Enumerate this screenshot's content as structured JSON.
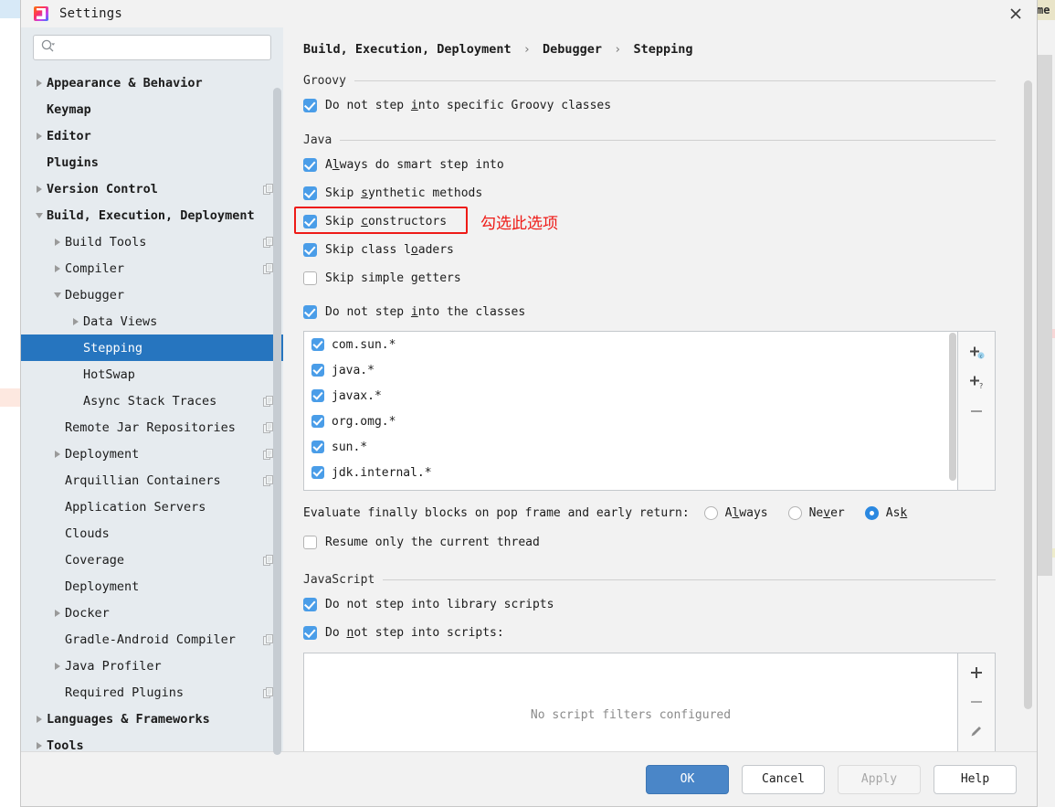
{
  "window": {
    "title": "Settings",
    "app_icon": "intellij-idea-icon",
    "close_label": "close-icon"
  },
  "sidebar": {
    "search": {
      "placeholder": "",
      "value": "",
      "icon": "search-icon"
    },
    "items": [
      {
        "label": "Appearance & Behavior",
        "level": 0,
        "arrow": "right",
        "bold": true,
        "copy": false,
        "selected": false
      },
      {
        "label": "Keymap",
        "level": 0,
        "arrow": "none",
        "bold": true,
        "copy": false,
        "selected": false
      },
      {
        "label": "Editor",
        "level": 0,
        "arrow": "right",
        "bold": true,
        "copy": false,
        "selected": false
      },
      {
        "label": "Plugins",
        "level": 0,
        "arrow": "none",
        "bold": true,
        "copy": false,
        "selected": false
      },
      {
        "label": "Version Control",
        "level": 0,
        "arrow": "right",
        "bold": true,
        "copy": true,
        "selected": false
      },
      {
        "label": "Build, Execution, Deployment",
        "level": 0,
        "arrow": "down",
        "bold": true,
        "copy": false,
        "selected": false
      },
      {
        "label": "Build Tools",
        "level": 1,
        "arrow": "right",
        "bold": false,
        "copy": true,
        "selected": false
      },
      {
        "label": "Compiler",
        "level": 1,
        "arrow": "right",
        "bold": false,
        "copy": true,
        "selected": false
      },
      {
        "label": "Debugger",
        "level": 1,
        "arrow": "down",
        "bold": false,
        "copy": false,
        "selected": false
      },
      {
        "label": "Data Views",
        "level": 2,
        "arrow": "right",
        "bold": false,
        "copy": false,
        "selected": false
      },
      {
        "label": "Stepping",
        "level": 2,
        "arrow": "none",
        "bold": false,
        "copy": false,
        "selected": true
      },
      {
        "label": "HotSwap",
        "level": 2,
        "arrow": "none",
        "bold": false,
        "copy": false,
        "selected": false
      },
      {
        "label": "Async Stack Traces",
        "level": 2,
        "arrow": "none",
        "bold": false,
        "copy": true,
        "selected": false
      },
      {
        "label": "Remote Jar Repositories",
        "level": 1,
        "arrow": "none",
        "bold": false,
        "copy": true,
        "selected": false
      },
      {
        "label": "Deployment",
        "level": 1,
        "arrow": "right",
        "bold": false,
        "copy": true,
        "selected": false
      },
      {
        "label": "Arquillian Containers",
        "level": 1,
        "arrow": "none",
        "bold": false,
        "copy": true,
        "selected": false
      },
      {
        "label": "Application Servers",
        "level": 1,
        "arrow": "none",
        "bold": false,
        "copy": false,
        "selected": false
      },
      {
        "label": "Clouds",
        "level": 1,
        "arrow": "none",
        "bold": false,
        "copy": false,
        "selected": false
      },
      {
        "label": "Coverage",
        "level": 1,
        "arrow": "none",
        "bold": false,
        "copy": true,
        "selected": false
      },
      {
        "label": "Deployment",
        "level": 1,
        "arrow": "none",
        "bold": false,
        "copy": false,
        "selected": false
      },
      {
        "label": "Docker",
        "level": 1,
        "arrow": "right",
        "bold": false,
        "copy": false,
        "selected": false
      },
      {
        "label": "Gradle-Android Compiler",
        "level": 1,
        "arrow": "none",
        "bold": false,
        "copy": true,
        "selected": false
      },
      {
        "label": "Java Profiler",
        "level": 1,
        "arrow": "right",
        "bold": false,
        "copy": false,
        "selected": false
      },
      {
        "label": "Required Plugins",
        "level": 1,
        "arrow": "none",
        "bold": false,
        "copy": true,
        "selected": false
      },
      {
        "label": "Languages & Frameworks",
        "level": 0,
        "arrow": "right",
        "bold": true,
        "copy": false,
        "selected": false
      },
      {
        "label": "Tools",
        "level": 0,
        "arrow": "right",
        "bold": true,
        "copy": false,
        "selected": false
      }
    ]
  },
  "main": {
    "breadcrumb": {
      "part1": "Build, Execution, Deployment",
      "part2": "Debugger",
      "part3": "Stepping",
      "separator": "›"
    },
    "groovy": {
      "title": "Groovy",
      "options": [
        {
          "label_pre": "Do not step ",
          "label_u": "i",
          "label_post": "nto specific Groovy classes",
          "checked": true
        }
      ]
    },
    "java": {
      "title": "Java",
      "options": [
        {
          "label_pre": "A",
          "label_u": "l",
          "label_post": "ways do smart step into",
          "checked": true
        },
        {
          "label_pre": "Skip ",
          "label_u": "s",
          "label_post": "ynthetic methods",
          "checked": true
        },
        {
          "label_pre": "Skip ",
          "label_u": "c",
          "label_post": "onstructors",
          "checked": true
        },
        {
          "label_pre": "Skip class l",
          "label_u": "o",
          "label_post": "aders",
          "checked": true
        },
        {
          "label_pre": "Skip simple ",
          "label_u": "g",
          "label_post": "etters",
          "checked": false
        },
        {
          "label_pre": "Do not step ",
          "label_u": "i",
          "label_post": "nto the classes",
          "checked": true
        }
      ],
      "class_filters": [
        {
          "pattern": "com.sun.*",
          "checked": true
        },
        {
          "pattern": "java.*",
          "checked": true
        },
        {
          "pattern": "javax.*",
          "checked": true
        },
        {
          "pattern": "org.omg.*",
          "checked": true
        },
        {
          "pattern": "sun.*",
          "checked": true
        },
        {
          "pattern": "jdk.internal.*",
          "checked": true
        }
      ],
      "class_buttons": [
        {
          "icon": "add-class-icon",
          "name": "add-class-button"
        },
        {
          "icon": "add-pattern-icon",
          "name": "add-pattern-button"
        },
        {
          "icon": "remove-icon",
          "name": "remove-class-button"
        }
      ],
      "evaluate_label": "Evaluate finally blocks on pop frame and early return:",
      "evaluate_options": [
        {
          "pre": "A",
          "u": "l",
          "post": "ways",
          "selected": false
        },
        {
          "pre": "Ne",
          "u": "v",
          "post": "er",
          "selected": false
        },
        {
          "pre": "As",
          "u": "k",
          "post": "",
          "selected": true
        }
      ],
      "resume_option": {
        "label": "Resume only the current thread",
        "checked": false
      }
    },
    "javascript": {
      "title": "JavaScript",
      "options": [
        {
          "label_pre": "Do not step into library scripts",
          "label_u": "",
          "label_post": "",
          "checked": true
        },
        {
          "label_pre": "Do ",
          "label_u": "n",
          "label_post": "ot step into scripts:",
          "checked": true
        }
      ],
      "empty_text": "No script filters configured",
      "script_buttons": [
        {
          "icon": "plus-icon",
          "name": "add-script-filter-button"
        },
        {
          "icon": "minus-icon",
          "name": "remove-script-filter-button"
        },
        {
          "icon": "pencil-icon",
          "name": "edit-script-filter-button"
        },
        {
          "icon": "up-arrow-icon",
          "name": "move-up-script-filter-button"
        }
      ]
    },
    "annotation": {
      "text": "勾选此选项",
      "color": "#ee1b17",
      "target": "Skip constructors"
    }
  },
  "footer": {
    "ok": "OK",
    "cancel": "Cancel",
    "apply": "Apply",
    "help": "Help"
  },
  "colors": {
    "accent": "#2675bf",
    "checkbox": "#4a9de8",
    "primary_button": "#4a86c8",
    "annotation_red": "#ee1b17",
    "sidebar_bg": "#e6ebef",
    "panel_bg": "#f2f2f2"
  }
}
